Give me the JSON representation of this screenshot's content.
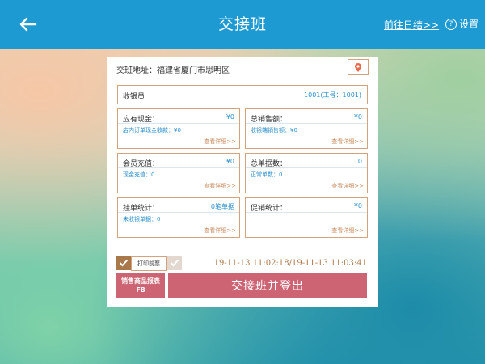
{
  "header": {
    "title": "交接班",
    "summary_link": "前往日结>>",
    "settings_label": "设置",
    "settings_icon_glyph": "?"
  },
  "shift": {
    "address": "交班地址：福建省厦门市思明区",
    "cashier_label": "收银员",
    "cashier_value": "1001(工号：1001)"
  },
  "cards": [
    {
      "label": "应有现金：",
      "value": "¥0",
      "sub": "店内订单现金收款：¥0",
      "more": "查看详细>>"
    },
    {
      "label": "总销售额：",
      "value": "¥0",
      "sub": "收银端销售额：¥0",
      "more": "查看详细>>"
    },
    {
      "label": "会员充值：",
      "value": "¥0",
      "sub": "现金充值：0",
      "more": "查看详细>>"
    },
    {
      "label": "总单据数：",
      "value": "0",
      "sub": "正常单数：0",
      "more": "查看详细>>"
    },
    {
      "label": "挂单统计：",
      "value": "0笔单据",
      "sub": "未收银单据：0",
      "more": "查看详细>>"
    },
    {
      "label": "促销统计：",
      "value": "¥0",
      "sub": "",
      "more": "查看详细>>"
    }
  ],
  "footer": {
    "print_label": "打印前票",
    "time_range": "19-11-13 11:02:18/19-11-13 11:03:41",
    "report_btn_line1": "销售商品报表",
    "report_btn_line2": "F8",
    "logout_btn": "交接班并登出"
  },
  "colors": {
    "header": "#1d9ad2",
    "accent": "#cc6474",
    "border": "#d5a27c",
    "value_blue": "#2a8fcc"
  }
}
